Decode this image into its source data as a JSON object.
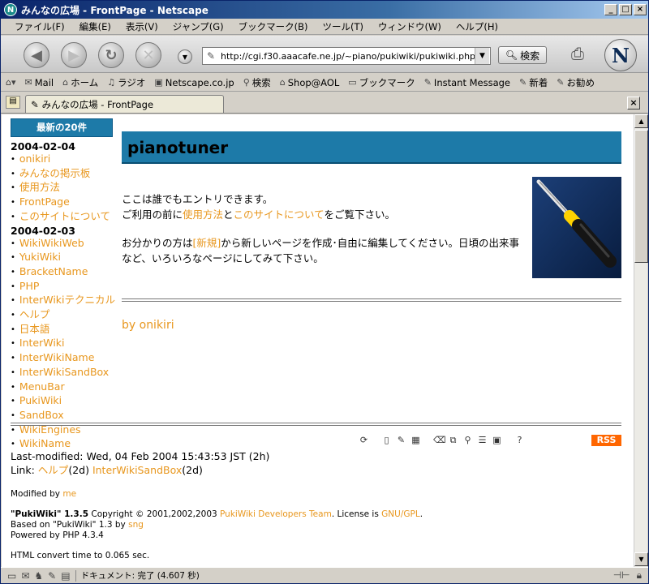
{
  "window": {
    "title": "みんなの広場 - FrontPage - Netscape",
    "controls": [
      "_",
      "□",
      "×"
    ]
  },
  "menu": [
    "ファイル(F)",
    "編集(E)",
    "表示(V)",
    "ジャンプ(G)",
    "ブックマーク(B)",
    "ツール(T)",
    "ウィンドウ(W)",
    "ヘルプ(H)"
  ],
  "navbar": {
    "url": "http://cgi.f30.aaacafe.ne.jp/~piano/pukiwiki/pukiwiki.php",
    "search_label": "検索"
  },
  "personal_toolbar": [
    "Mail",
    "ホーム",
    "ラジオ",
    "Netscape.co.jp",
    "検索",
    "Shop@AOL",
    "ブックマーク",
    "Instant Message",
    "新着",
    "お勧め"
  ],
  "tab": {
    "label": "みんなの広場 - FrontPage"
  },
  "sidebar": {
    "heading": "最新の20件",
    "groups": [
      {
        "date": "2004-02-04",
        "items": [
          "onikiri",
          "みんなの掲示板",
          "使用方法",
          "FrontPage",
          "このサイトについて"
        ]
      },
      {
        "date": "2004-02-03",
        "items": [
          "WikiWikiWeb",
          "YukiWiki",
          "BracketName",
          "PHP",
          "InterWikiテクニカル",
          "ヘルプ",
          "日本語",
          "InterWiki",
          "InterWikiName",
          "InterWikiSandBox",
          "MenuBar",
          "PukiWiki",
          "SandBox",
          "WikiEngines",
          "WikiName"
        ]
      }
    ]
  },
  "main": {
    "title": "pianotuner",
    "para1_line1": "ここは誰でもエントリできます。",
    "para1_prefix": "ご利用の前に",
    "para1_link1": "使用方法",
    "para1_mid": "と",
    "para1_link2": "このサイトについて",
    "para1_suffix": "をご覧下さい。",
    "para2_prefix": "お分かりの方は",
    "para2_link": "[新規]",
    "para2_suffix": "から新しいページを作成･自由に編集してください。日頃の出来事など、いろいろなページにしてみて下さい。",
    "byline": "by onikiri"
  },
  "footer": {
    "rss": "RSS",
    "last_modified": "Last-modified: Wed, 04 Feb 2004 15:43:53 JST (2h)",
    "link_label": "Link:",
    "link1": "ヘルプ",
    "link1_age": "(2d)",
    "link2": "InterWikiSandBox",
    "link2_age": "(2d)",
    "modified_by_label": "Modified by",
    "modified_by": "me",
    "pukiwiki_name": "\"PukiWiki\" 1.3.5",
    "copyright_text": "Copyright © 2001,2002,2003",
    "dev_team": "PukiWiki Developers Team",
    "license_label": ". License is",
    "license": "GNU/GPL",
    "based_on": "Based on \"PukiWiki\" 1.3 by",
    "based_on_author": "sng",
    "powered_by": "Powered by PHP 4.3.4",
    "convert_time": "HTML convert time to 0.065 sec."
  },
  "status": {
    "text": "ドキュメント: 完了 (4.607 秒)"
  }
}
